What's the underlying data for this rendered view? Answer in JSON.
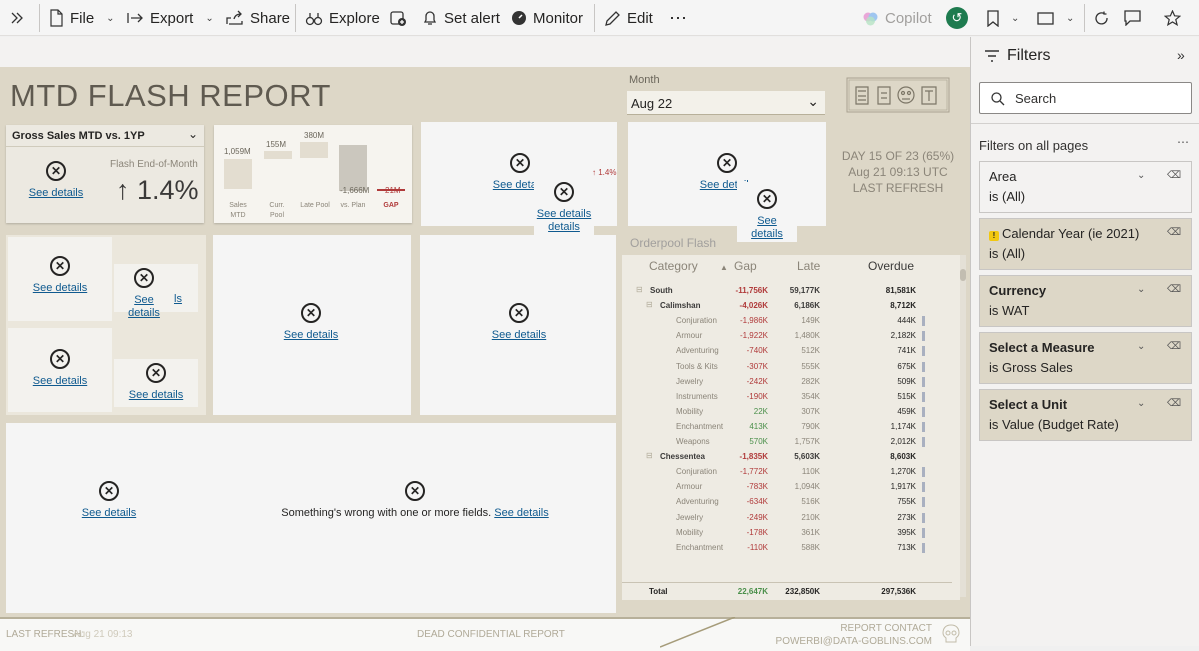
{
  "toolbar": {
    "file": "File",
    "export": "Export",
    "share": "Share",
    "explore": "Explore",
    "set_alert": "Set alert",
    "monitor": "Monitor",
    "edit": "Edit",
    "copilot": "Copilot"
  },
  "report": {
    "title": "MTD FLASH REPORT",
    "month_label": "Month",
    "month_value": "Aug 22",
    "day_info": "DAY 15 OF 23 (65%)",
    "refresh_time": "Aug 21 09:13 UTC",
    "last_refresh_label": "LAST REFRESH",
    "kpi_dropdown": "Gross Sales MTD vs. 1YP",
    "flash_label": "Flash End-of-Month",
    "flash_value": "↑ 1.4%",
    "small_value": "↑ 1.4%",
    "see_details": "See details",
    "fields_error": "Something's wrong with one or more fields.",
    "partial_is": "ls",
    "orderpool_title": "Orderpool Flash"
  },
  "waterfall": {
    "labels": [
      "1,059M",
      "155M",
      "380M",
      "-1,666M",
      "21M"
    ],
    "cats": [
      "Sales\nMTD",
      "Curr.\nPool",
      "Late Pool",
      "vs. Plan",
      "GAP"
    ]
  },
  "matrix": {
    "headers": [
      "Category",
      "Gap",
      "Late",
      "Overdue"
    ],
    "rows": [
      {
        "level": 0,
        "cat": "South",
        "gap": "-11,756K",
        "late": "59,177K",
        "ov": "81,581K",
        "neg": true
      },
      {
        "level": 1,
        "cat": "Calimshan",
        "gap": "-4,026K",
        "late": "6,186K",
        "ov": "8,712K",
        "neg": true
      },
      {
        "level": 2,
        "cat": "Conjuration",
        "gap": "-1,986K",
        "late": "149K",
        "ov": "444K",
        "neg": true
      },
      {
        "level": 2,
        "cat": "Armour",
        "gap": "-1,922K",
        "late": "1,480K",
        "ov": "2,182K",
        "neg": true
      },
      {
        "level": 2,
        "cat": "Adventuring",
        "gap": "-740K",
        "late": "512K",
        "ov": "741K",
        "neg": true
      },
      {
        "level": 2,
        "cat": "Tools & Kits",
        "gap": "-307K",
        "late": "555K",
        "ov": "675K",
        "neg": true
      },
      {
        "level": 2,
        "cat": "Jewelry",
        "gap": "-242K",
        "late": "282K",
        "ov": "509K",
        "neg": true
      },
      {
        "level": 2,
        "cat": "Instruments",
        "gap": "-190K",
        "late": "354K",
        "ov": "515K",
        "neg": true
      },
      {
        "level": 2,
        "cat": "Mobility",
        "gap": "22K",
        "late": "307K",
        "ov": "459K",
        "neg": false
      },
      {
        "level": 2,
        "cat": "Enchantment",
        "gap": "413K",
        "late": "790K",
        "ov": "1,174K",
        "neg": false
      },
      {
        "level": 2,
        "cat": "Weapons",
        "gap": "570K",
        "late": "1,757K",
        "ov": "2,012K",
        "neg": false
      },
      {
        "level": 1,
        "cat": "Chessentea",
        "gap": "-1,835K",
        "late": "5,603K",
        "ov": "8,603K",
        "neg": true
      },
      {
        "level": 2,
        "cat": "Conjuration",
        "gap": "-1,772K",
        "late": "110K",
        "ov": "1,270K",
        "neg": true
      },
      {
        "level": 2,
        "cat": "Armour",
        "gap": "-783K",
        "late": "1,094K",
        "ov": "1,917K",
        "neg": true
      },
      {
        "level": 2,
        "cat": "Adventuring",
        "gap": "-634K",
        "late": "516K",
        "ov": "755K",
        "neg": true
      },
      {
        "level": 2,
        "cat": "Jewelry",
        "gap": "-249K",
        "late": "210K",
        "ov": "273K",
        "neg": true
      },
      {
        "level": 2,
        "cat": "Mobility",
        "gap": "-178K",
        "late": "361K",
        "ov": "395K",
        "neg": true
      },
      {
        "level": 2,
        "cat": "Enchantment",
        "gap": "-110K",
        "late": "588K",
        "ov": "713K",
        "neg": true
      }
    ],
    "total": {
      "cat": "Total",
      "gap": "22,647K",
      "late": "232,850K",
      "ov": "297,536K"
    }
  },
  "footer": {
    "last_refresh_label": "LAST REFRESH:",
    "last_refresh_value": "Aug 21 09:13",
    "confidential": "DEAD CONFIDENTIAL REPORT",
    "contact_label": "REPORT CONTACT",
    "contact_email": "POWERBI@DATA-GOBLINS.COM"
  },
  "filters": {
    "title": "Filters",
    "search_placeholder": "Search",
    "section": "Filters on all pages",
    "cards": [
      {
        "title": "Area",
        "value": "is (All)",
        "bold": false,
        "shaded": false
      },
      {
        "title": "Calendar Year (ie 2021)",
        "value": "is (All)",
        "bold": false,
        "shaded": true
      },
      {
        "title": "Currency",
        "value": "is WAT",
        "bold": true,
        "shaded": true
      },
      {
        "title": "Select a Measure",
        "value": "is Gross Sales",
        "bold": true,
        "shaded": true
      },
      {
        "title": "Select a Unit",
        "value": "is Value (Budget Rate)",
        "bold": true,
        "shaded": true
      }
    ]
  }
}
